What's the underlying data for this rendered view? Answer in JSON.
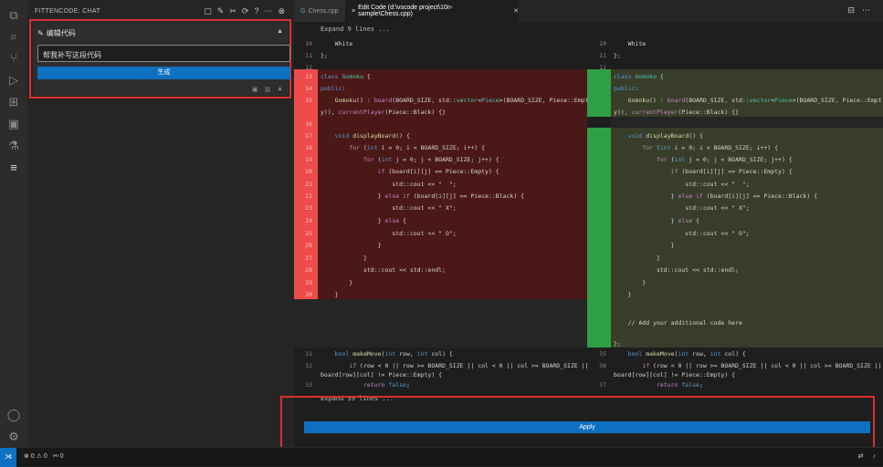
{
  "activity_bar": [
    {
      "name": "explorer-icon",
      "glyph": "⧉"
    },
    {
      "name": "search-icon",
      "glyph": "⌕"
    },
    {
      "name": "source-control-icon",
      "glyph": "⑂"
    },
    {
      "name": "run-debug-icon",
      "glyph": "▷"
    },
    {
      "name": "extensions-icon",
      "glyph": "⊞"
    },
    {
      "name": "remote-explorer-icon",
      "glyph": "▣"
    },
    {
      "name": "testing-icon",
      "glyph": "⚗"
    },
    {
      "name": "fittencode-icon",
      "glyph": "≡"
    }
  ],
  "activity_bottom": [
    {
      "name": "account-icon",
      "glyph": "◯"
    },
    {
      "name": "manage-gear-icon",
      "glyph": "⚙"
    }
  ],
  "sidebar": {
    "title": "FITTENCODE: CHAT",
    "actions": [
      "▢",
      "✎",
      "✂",
      "⟳",
      "?",
      "⋯",
      "⊗"
    ]
  },
  "edit_panel": {
    "title": "编辑代码",
    "input_value": "帮我补写这段代码",
    "generate_label": "生成"
  },
  "tabs": [
    {
      "label": "Chess.cpp",
      "active": false
    },
    {
      "label": "Edit Code (d:\\vscode project\\10n-sample\\Chess.cpp)",
      "active": true
    }
  ],
  "expand_top": "Expand 9 lines ...",
  "expand_bottom": "Expand 39 lines ...",
  "apply_label": "Apply",
  "status": {
    "errors": "⊗ 0 ⚠ 0",
    "ports": "⚯ 0"
  }
}
